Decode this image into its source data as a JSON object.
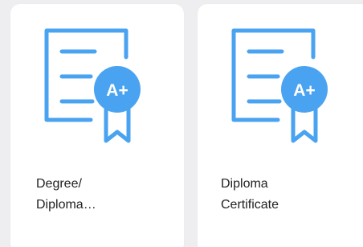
{
  "accent_color": "#4aa3f0",
  "cards": [
    {
      "label": "Degree/\nDiploma…",
      "icon": "certificate-a-plus-icon"
    },
    {
      "label": "Diploma\nCertificate",
      "icon": "certificate-a-plus-icon"
    }
  ]
}
